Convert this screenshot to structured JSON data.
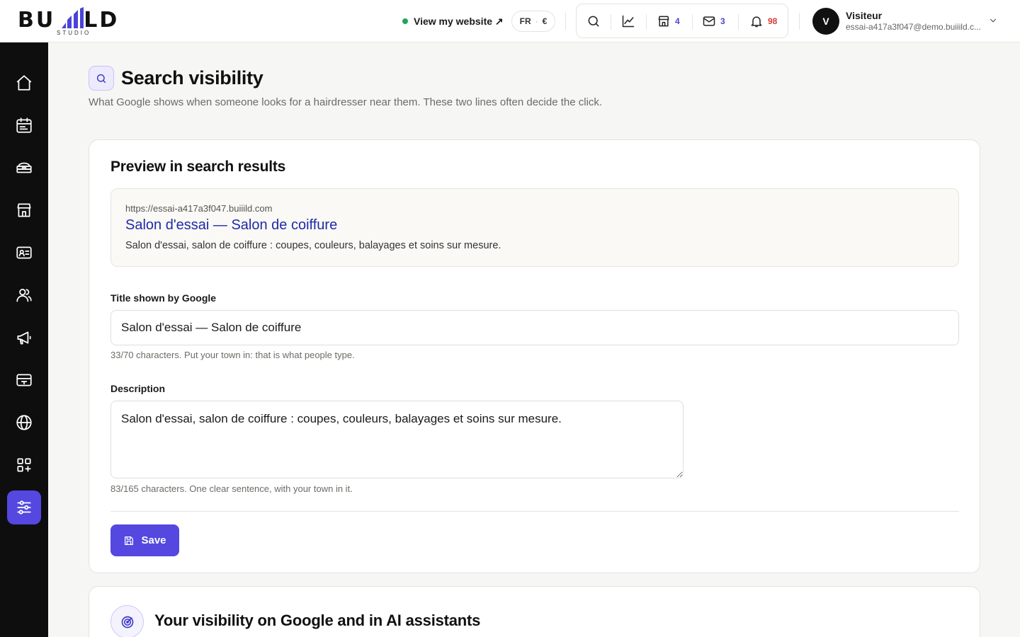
{
  "brand": {
    "logo_text": "BUILD",
    "logo_left": "BU",
    "logo_right": "LD",
    "logo_sub": "STUDIO"
  },
  "header": {
    "site_link": "View my website ↗",
    "lang": "FR",
    "lang_sep": "·",
    "currency": "€",
    "counts": {
      "shop": "4",
      "mail": "3",
      "notifications": "98"
    }
  },
  "user": {
    "initial": "V",
    "name": "Visiteur",
    "email": "essai-a417a3f047@demo.buiiild.c..."
  },
  "sidebar": {
    "items": [
      {
        "icon": "home-icon"
      },
      {
        "icon": "calendar-icon"
      },
      {
        "icon": "services-icon"
      },
      {
        "icon": "store-icon"
      },
      {
        "icon": "contact-card-icon"
      },
      {
        "icon": "users-icon"
      },
      {
        "icon": "megaphone-icon"
      },
      {
        "icon": "payment-card-icon"
      },
      {
        "icon": "globe-icon"
      },
      {
        "icon": "apps-icon"
      },
      {
        "icon": "settings-sliders-icon"
      }
    ],
    "active_index": 10
  },
  "page": {
    "title": "Search visibility",
    "subtitle": "What Google shows when someone looks for a hairdresser near them. These two lines often decide the click."
  },
  "preview_card": {
    "title": "Preview in search results",
    "url": "https://essai-a417a3f047.buiiild.com",
    "result_title": "Salon d'essai — Salon de coiffure",
    "result_description": "Salon d'essai, salon de coiffure : coupes, couleurs, balayages et soins sur mesure."
  },
  "form": {
    "title_label": "Title shown by Google",
    "title_value": "Salon d'essai — Salon de coiffure",
    "title_hint": "33/70 characters. Put your town in: that is what people type.",
    "description_label": "Description",
    "description_value": "Salon d'essai, salon de coiffure : coupes, couleurs, balayages et soins sur mesure.",
    "description_hint": "83/165 characters. One clear sentence, with your town in it.",
    "save_label": "Save"
  },
  "visibility_card": {
    "title": "Your visibility on Google and in AI assistants"
  },
  "colors": {
    "accent": "#5448e0",
    "link": "#1f2aa8",
    "status_green": "#22a55a",
    "alert_red": "#d63b3b"
  }
}
